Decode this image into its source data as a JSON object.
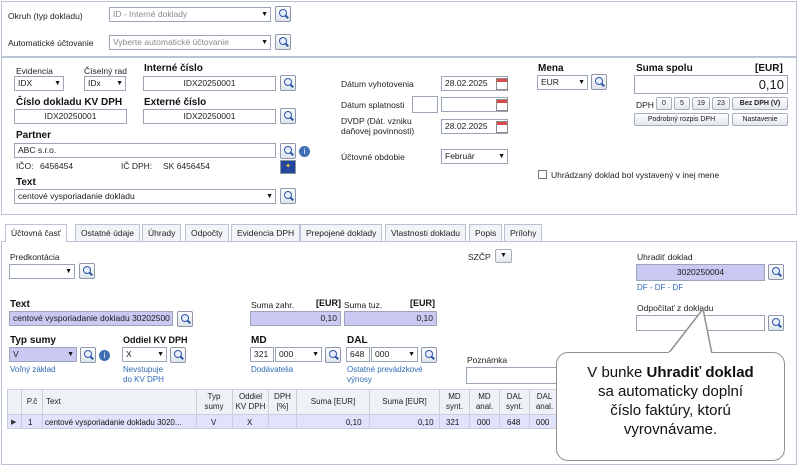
{
  "top": {
    "okruh_label": "Okruh (typ dokladu)",
    "okruh_value": "ID - Interné doklady",
    "auto_label": "Automatické účtovanie",
    "auto_placeholder": "Vyberte automatické účtovanie"
  },
  "header": {
    "evidencia_label": "Evidencia",
    "evidencia_value": "IDX",
    "ciselny_rad_label": "Číselný rad",
    "ciselny_rad_value": "IDx",
    "interne_cislo_label": "Interné číslo",
    "interne_cislo_value": "IDX20250001",
    "cislo_kv_label": "Číslo dokladu KV DPH",
    "cislo_kv_value": "IDX20250001",
    "externe_cislo_label": "Externé číslo",
    "externe_cislo_value": "IDX20250001",
    "partner_label": "Partner",
    "partner_value": "ABC s.r.o.",
    "ico_label": "IČO:",
    "ico_value": "6456454",
    "ic_dph_label": "IČ DPH:",
    "ic_dph_value": "SK 6456454",
    "text_label": "Text",
    "text_value": "centové vysporiadanie dokladu"
  },
  "dates": {
    "vyhotovenia_label": "Dátum vyhotovenia",
    "vyhotovenia_value": "28.02.2025",
    "splatnosti_label": "Dátum splatnosti",
    "dvdp_label": "DVDP (Dát. vzniku daňovej povinnosti)",
    "dvdp_value": "28.02.2025",
    "obdobie_label": "Účtovné obdobie",
    "obdobie_value": "Február"
  },
  "mena": {
    "label": "Mena",
    "value": "EUR",
    "checkbox_label": "Uhrádzaný doklad bol vystavený v inej mene"
  },
  "suma": {
    "label": "Suma spolu",
    "currency": "[EUR]",
    "value": "0,10",
    "dph_label": "DPH",
    "rates": [
      "0",
      "5",
      "19",
      "23"
    ],
    "bez_dph": "Bez DPH (V)",
    "rozpis": "Podrobný rozpis DPH",
    "nastavenie": "Nastavenie"
  },
  "tabs": [
    "Účtovná časť",
    "Ostatné údaje",
    "Úhrady",
    "Odpočty",
    "Evidencia DPH",
    "Prepojené doklady",
    "Vlastnosti dokladu",
    "Popis",
    "Prílohy"
  ],
  "accounting": {
    "predkontacia_label": "Predkontácia",
    "szcp_label": "SZČP",
    "uhradit_label": "Uhradiť doklad",
    "uhradit_value": "3020250004",
    "uhradit_link": "DF - DF - DF",
    "odpocitat_label": "Odpočítať z dokladu",
    "text_label": "Text",
    "text_value": "centové vysporiadanie dokladu 30202500",
    "suma_zahr_label": "Suma zahr.",
    "suma_zahr_cur": "[EUR]",
    "suma_zahr_value": "0,10",
    "suma_tuz_label": "Suma tuz.",
    "suma_tuz_cur": "[EUR]",
    "suma_tuz_value": "0,10",
    "typ_sumy_label": "Typ sumy",
    "typ_sumy_value": "V",
    "typ_sumy_link": "Voľný základ",
    "oddiel_label": "Oddiel KV DPH",
    "oddiel_value": "X",
    "oddiel_link1": "Nevstupuje",
    "oddiel_link2": "do KV DPH",
    "md_label": "MD",
    "md_synt": "321",
    "md_anal": "000",
    "md_link": "Dodávatelia",
    "dal_label": "DAL",
    "dal_synt": "648",
    "dal_anal": "000",
    "dal_link1": "Ostatné prevádzkové",
    "dal_link2": "výnosy",
    "poznamka_label": "Poznámka"
  },
  "grid": {
    "headers": [
      "P.č",
      "Text",
      "Typ sumy",
      "Oddiel KV DPH",
      "DPH [%]",
      "Suma [EUR]",
      "Suma [EUR]",
      "MD synt.",
      "MD anal.",
      "DAL synt.",
      "DAL anal."
    ],
    "row": [
      "1",
      "centové vysporiadanie dokladu 3020...",
      "V",
      "X",
      "",
      "0,10",
      "0,10",
      "321",
      "000",
      "648",
      "000"
    ]
  },
  "callout": {
    "line1_pre": "V bunke ",
    "line1_bold": "Uhradiť doklad",
    "line2": "sa automaticky doplní",
    "line3": "číslo faktúry, ktorú",
    "line4": "vyrovnávame."
  },
  "colors": {
    "highlight_field": "#c9c9f3",
    "link": "#2f6bb5",
    "border": "#b9c3d4"
  }
}
